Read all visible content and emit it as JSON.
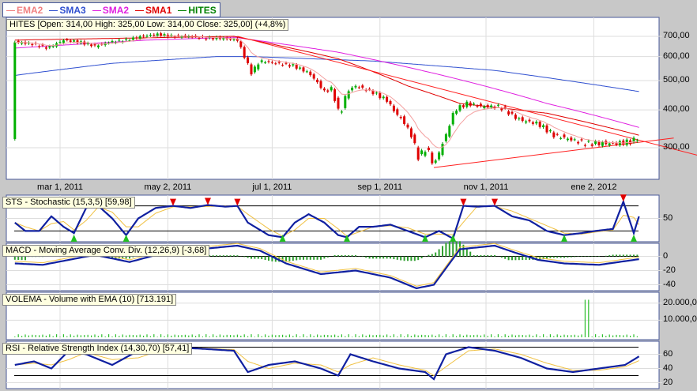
{
  "legend": [
    {
      "label": "EMA2",
      "color": "#f08080"
    },
    {
      "label": "SMA3",
      "color": "#3050d0"
    },
    {
      "label": "SMA2",
      "color": "#e020e0"
    },
    {
      "label": "SMA1",
      "color": "#e00000"
    },
    {
      "label": "HITES",
      "color": "#008000"
    }
  ],
  "panels": {
    "price_title": "HITES [Open: 314,00  High: 325,00  Low: 314,00  Close: 325,00] (+4,8%)",
    "sts_title": "STS - Stochastic (15,3,5) [59,98]",
    "macd_title": "MACD - Moving Average Conv. Div. (12,26,9) [-3,68]",
    "vol_title": "VOLEMA - Volume with EMA (10) [713.191]",
    "rsi_title": "RSI - Relative Strength Index (14,30,70) [57,41]"
  },
  "chart_data": {
    "type": "line",
    "x_unit": "days since mar 1, 2011",
    "x_ticks": [
      {
        "d": 0,
        "label": "mar 1, 2011"
      },
      {
        "d": 62,
        "label": "may 2, 2011"
      },
      {
        "d": 122,
        "label": "jul 1, 2011"
      },
      {
        "d": 184,
        "label": "sep 1, 2011"
      },
      {
        "d": 245,
        "label": "nov 1, 2011"
      },
      {
        "d": 307,
        "label": "ene 2, 2012"
      }
    ],
    "price_ticks": [
      {
        "v": 700,
        "label": "700,00"
      },
      {
        "v": 600,
        "label": "600,00"
      },
      {
        "v": 500,
        "label": "500,00"
      },
      {
        "v": 400,
        "label": "400,00"
      },
      {
        "v": 300,
        "label": "300,00"
      }
    ],
    "price": [
      [
        -26,
        670
      ],
      [
        -16,
        660
      ],
      [
        -7,
        640
      ],
      [
        2,
        680
      ],
      [
        11,
        670
      ],
      [
        20,
        650
      ],
      [
        29,
        670
      ],
      [
        38,
        680
      ],
      [
        47,
        700
      ],
      [
        56,
        710
      ],
      [
        65,
        700
      ],
      [
        75,
        700
      ],
      [
        84,
        690
      ],
      [
        93,
        690
      ],
      [
        102,
        680
      ],
      [
        106,
        600
      ],
      [
        110,
        530
      ],
      [
        115,
        580
      ],
      [
        125,
        570
      ],
      [
        134,
        560
      ],
      [
        143,
        530
      ],
      [
        147,
        500
      ],
      [
        152,
        460
      ],
      [
        156,
        470
      ],
      [
        161,
        380
      ],
      [
        165,
        460
      ],
      [
        170,
        480
      ],
      [
        179,
        460
      ],
      [
        188,
        430
      ],
      [
        193,
        390
      ],
      [
        197,
        370
      ],
      [
        202,
        330
      ],
      [
        206,
        280
      ],
      [
        211,
        300
      ],
      [
        215,
        260
      ],
      [
        218,
        290
      ],
      [
        222,
        330
      ],
      [
        227,
        400
      ],
      [
        234,
        420
      ],
      [
        243,
        410
      ],
      [
        252,
        410
      ],
      [
        256,
        400
      ],
      [
        261,
        380
      ],
      [
        265,
        370
      ],
      [
        275,
        360
      ],
      [
        284,
        330
      ],
      [
        293,
        320
      ],
      [
        302,
        310
      ],
      [
        311,
        310
      ],
      [
        320,
        310
      ],
      [
        329,
        315
      ],
      [
        333,
        325
      ]
    ],
    "sma3": [
      [
        -26,
        520
      ],
      [
        30,
        570
      ],
      [
        90,
        600
      ],
      [
        110,
        600
      ],
      [
        180,
        580
      ],
      [
        250,
        540
      ],
      [
        333,
        460
      ]
    ],
    "sma2": [
      [
        -26,
        640
      ],
      [
        50,
        680
      ],
      [
        100,
        695
      ],
      [
        160,
        620
      ],
      [
        220,
        520
      ],
      [
        280,
        420
      ],
      [
        333,
        350
      ]
    ],
    "sma1": [
      [
        -26,
        680
      ],
      [
        100,
        700
      ],
      [
        160,
        590
      ],
      [
        200,
        480
      ],
      [
        230,
        420
      ],
      [
        280,
        390
      ],
      [
        333,
        330
      ]
    ],
    "trendlines": [
      [
        [
          102,
          700
        ],
        [
          367,
          283
        ]
      ],
      [
        [
          215,
          258
        ],
        [
          353,
          323
        ]
      ]
    ],
    "sts_ticks": [
      {
        "v": 50,
        "label": "50"
      }
    ],
    "sts": [
      [
        -26,
        40
      ],
      [
        -20,
        20
      ],
      [
        -12,
        20
      ],
      [
        -5,
        55
      ],
      [
        2,
        30
      ],
      [
        8,
        15
      ],
      [
        15,
        75
      ],
      [
        22,
        80
      ],
      [
        30,
        50
      ],
      [
        38,
        10
      ],
      [
        45,
        50
      ],
      [
        55,
        75
      ],
      [
        65,
        80
      ],
      [
        75,
        75
      ],
      [
        85,
        82
      ],
      [
        95,
        78
      ],
      [
        102,
        80
      ],
      [
        108,
        40
      ],
      [
        120,
        10
      ],
      [
        128,
        5
      ],
      [
        135,
        40
      ],
      [
        143,
        60
      ],
      [
        152,
        40
      ],
      [
        160,
        10
      ],
      [
        165,
        5
      ],
      [
        172,
        30
      ],
      [
        180,
        30
      ],
      [
        190,
        35
      ],
      [
        200,
        20
      ],
      [
        210,
        5
      ],
      [
        218,
        20
      ],
      [
        226,
        2
      ],
      [
        232,
        80
      ],
      [
        240,
        78
      ],
      [
        250,
        80
      ],
      [
        260,
        55
      ],
      [
        270,
        45
      ],
      [
        280,
        20
      ],
      [
        290,
        10
      ],
      [
        300,
        15
      ],
      [
        308,
        20
      ],
      [
        318,
        25
      ],
      [
        324,
        90
      ],
      [
        330,
        15
      ],
      [
        333,
        55
      ]
    ],
    "macd_ticks": [
      {
        "v": 0,
        "label": "0"
      },
      {
        "v": -20,
        "label": "-20"
      },
      {
        "v": -40,
        "label": "-40"
      }
    ],
    "macd": [
      [
        -26,
        -10
      ],
      [
        -10,
        -12
      ],
      [
        5,
        -5
      ],
      [
        20,
        2
      ],
      [
        40,
        -8
      ],
      [
        60,
        5
      ],
      [
        80,
        10
      ],
      [
        102,
        15
      ],
      [
        115,
        8
      ],
      [
        130,
        -10
      ],
      [
        150,
        -25
      ],
      [
        170,
        -20
      ],
      [
        190,
        -30
      ],
      [
        205,
        -45
      ],
      [
        215,
        -40
      ],
      [
        230,
        10
      ],
      [
        250,
        15
      ],
      [
        262,
        5
      ],
      [
        275,
        -5
      ],
      [
        290,
        -10
      ],
      [
        310,
        -12
      ],
      [
        333,
        -4
      ]
    ],
    "vol_ticks": [
      {
        "v": 20000,
        "label": "20.000,0"
      },
      {
        "v": 10000,
        "label": "10.000,0"
      }
    ],
    "volume_spike": {
      "d": 303,
      "value": 22000
    },
    "rsi_ticks": [
      {
        "v": 60,
        "label": "60"
      },
      {
        "v": 40,
        "label": "40"
      },
      {
        "v": 20,
        "label": "20"
      }
    ],
    "rsi": [
      [
        -26,
        45
      ],
      [
        -15,
        50
      ],
      [
        -5,
        40
      ],
      [
        5,
        65
      ],
      [
        15,
        60
      ],
      [
        30,
        45
      ],
      [
        45,
        65
      ],
      [
        60,
        70
      ],
      [
        80,
        68
      ],
      [
        100,
        65
      ],
      [
        108,
        35
      ],
      [
        120,
        45
      ],
      [
        135,
        50
      ],
      [
        150,
        40
      ],
      [
        160,
        30
      ],
      [
        167,
        60
      ],
      [
        180,
        50
      ],
      [
        195,
        40
      ],
      [
        210,
        35
      ],
      [
        215,
        25
      ],
      [
        222,
        60
      ],
      [
        235,
        70
      ],
      [
        250,
        65
      ],
      [
        265,
        55
      ],
      [
        280,
        40
      ],
      [
        295,
        35
      ],
      [
        310,
        40
      ],
      [
        325,
        45
      ],
      [
        333,
        57
      ]
    ]
  }
}
